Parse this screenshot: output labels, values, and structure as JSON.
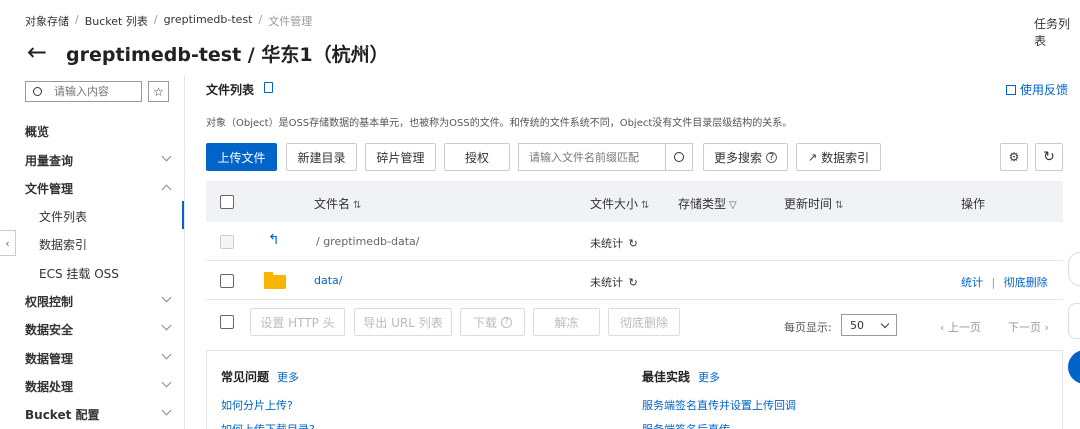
{
  "breadcrumb": [
    "对象存储",
    "Bucket 列表",
    "greptimedb-test",
    "文件管理"
  ],
  "top_right": "任务列表",
  "page_title": "greptimedb-test / 华东1（杭州）",
  "sidebar": {
    "search_placeholder": "请输入内容",
    "items": [
      {
        "label": "概览"
      },
      {
        "label": "用量查询"
      },
      {
        "label": "文件管理"
      },
      {
        "label": "文件列表"
      },
      {
        "label": "数据索引"
      },
      {
        "label": "ECS 挂载 OSS"
      },
      {
        "label": "权限控制"
      },
      {
        "label": "数据安全"
      },
      {
        "label": "数据管理"
      },
      {
        "label": "数据处理"
      },
      {
        "label": "Bucket 配置"
      }
    ]
  },
  "main": {
    "section_title": "文件列表",
    "feedback": "使用反馈",
    "description": "对象（Object）是OSS存储数据的基本单元，也被称为OSS的文件。和传统的文件系统不同，Object没有文件目录层级结构的关系。",
    "toolbar": {
      "upload": "上传文件",
      "new_dir": "新建目录",
      "fragments": "碎片管理",
      "authorize": "授权",
      "search_placeholder": "请输入文件名前缀匹配",
      "more_search": "更多搜索",
      "data_index": "数据索引"
    },
    "table": {
      "headers": [
        "文件名",
        "文件大小",
        "存储类型",
        "更新时间",
        "操作"
      ],
      "rows": [
        {
          "name": "/ greptimedb-data/",
          "size": "未统计"
        },
        {
          "name": "data/",
          "size": "未统计",
          "actions": [
            "统计",
            "彻底删除"
          ]
        }
      ]
    },
    "bulk_actions": [
      "设置 HTTP 头",
      "导出 URL 列表",
      "下载",
      "解冻",
      "彻底删除"
    ],
    "pagination": {
      "page_size_label": "每页显示:",
      "page_size": "50",
      "prev": "上一页",
      "next": "下一页"
    },
    "faq": {
      "title": "常见问题",
      "more": "更多",
      "items": [
        "如何分片上传?",
        "如何上传下载目录?"
      ]
    },
    "best_practice": {
      "title": "最佳实践",
      "more": "更多",
      "items": [
        "服务端签名直传并设置上传回调",
        "服务端签名后直传"
      ]
    }
  },
  "colors": {
    "accent": "#0064c8",
    "folder": "#f7b500"
  }
}
